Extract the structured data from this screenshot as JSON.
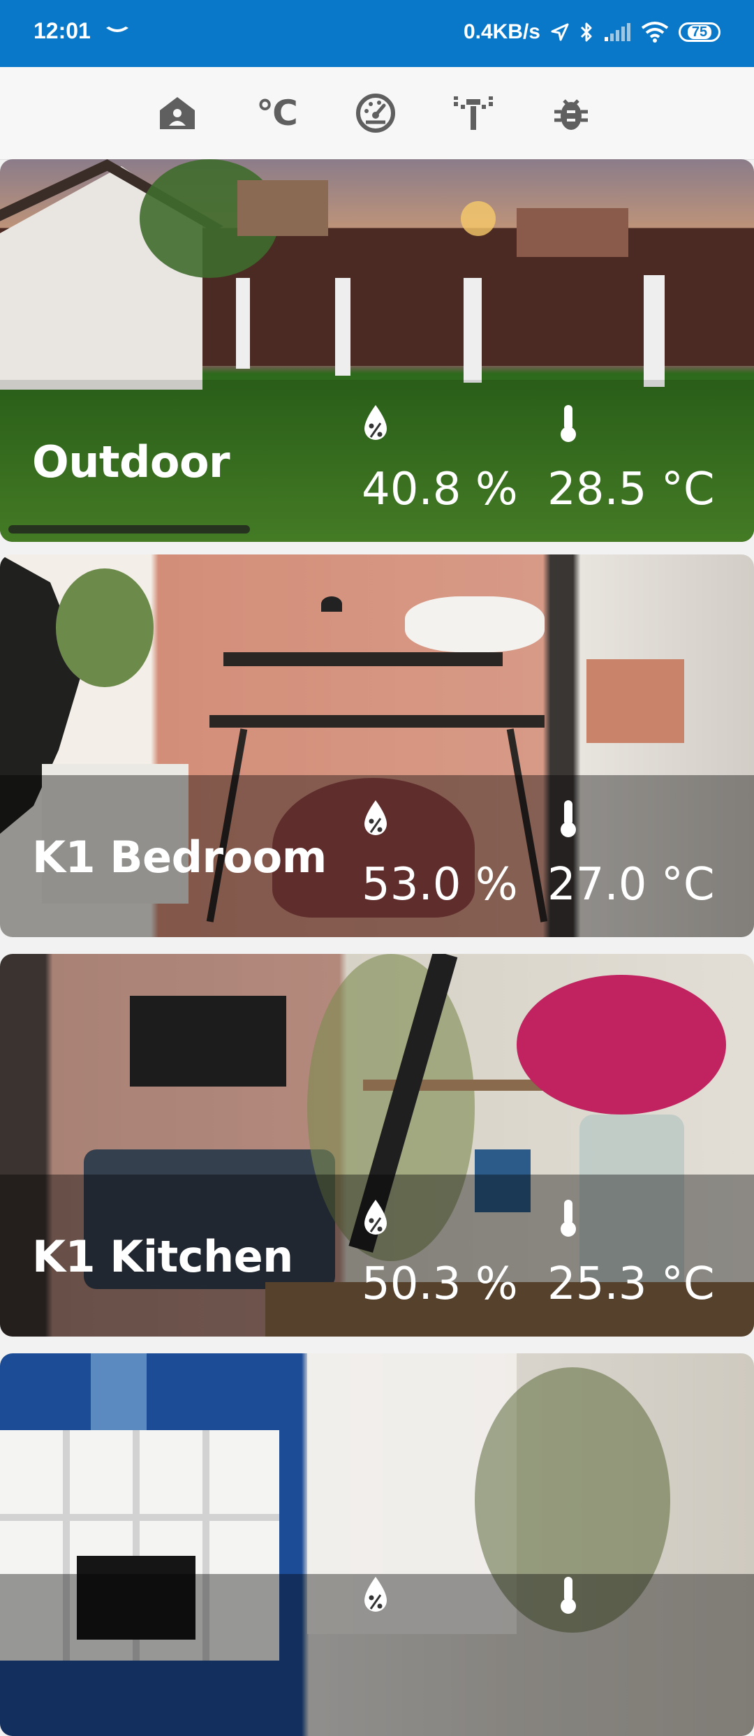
{
  "status_bar": {
    "time": "12:01",
    "network_speed": "0.4KB/s",
    "battery": "75"
  },
  "nav": {
    "icons": [
      "home-icon",
      "celsius-icon",
      "gauge-icon",
      "sensor-network-icon",
      "bug-icon"
    ],
    "celsius_label": "°C"
  },
  "rooms": [
    {
      "name": "Outdoor",
      "humidity": "40.8 %",
      "temperature": "28.5 °C"
    },
    {
      "name": "K1 Bedroom",
      "humidity": "53.0 %",
      "temperature": "27.0 °C"
    },
    {
      "name": "K1 Kitchen",
      "humidity": "50.3 %",
      "temperature": "25.3 °C"
    }
  ],
  "colors": {
    "status_bar": "#0a78c8",
    "nav_icon": "#5f5f5f",
    "card_text": "#ffffff"
  }
}
